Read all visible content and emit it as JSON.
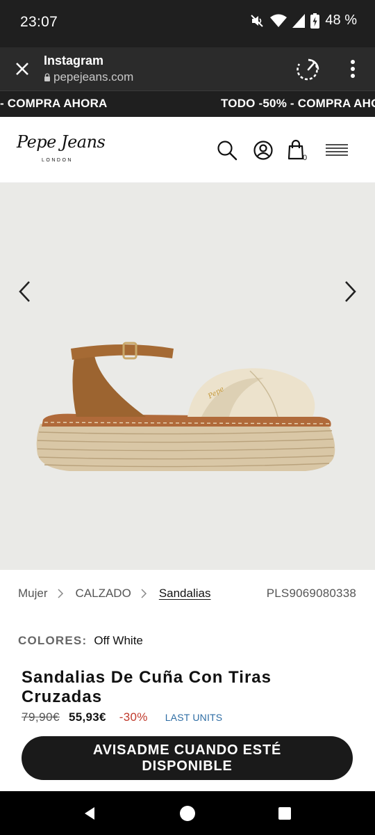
{
  "status_bar": {
    "time": "23:07",
    "battery_percent": "48 %",
    "icons": [
      "mute-icon",
      "wifi-icon",
      "signal-icon",
      "battery-charging-icon"
    ]
  },
  "browser": {
    "title": "Instagram",
    "url": "pepejeans.com"
  },
  "promo": {
    "text_left": "- COMPRA AHORA",
    "text_right": "TODO -50% - COMPRA AHO"
  },
  "header": {
    "logo_text": "Pepe Jeans",
    "logo_sub": "LONDON",
    "bag_count": "0"
  },
  "breadcrumb": {
    "items": [
      "Mujer",
      "CALZADO",
      "Sandalias"
    ]
  },
  "product": {
    "sku": "PLS9069080338",
    "colors_label": "COLORES:",
    "color_value": "Off White",
    "title": "Sandalias De Cuña Con Tiras Cruzadas",
    "price_old": "79,90€",
    "price_new": "55,93€",
    "discount": "-30%",
    "stock_badge": "LAST UNITS",
    "cta_label": "AVISADME CUANDO ESTÉ DISPONIBLE"
  },
  "colors": {
    "discount": "#c0392b",
    "stock_badge": "#2e6da4",
    "cta_background": "#1a1a1a"
  }
}
